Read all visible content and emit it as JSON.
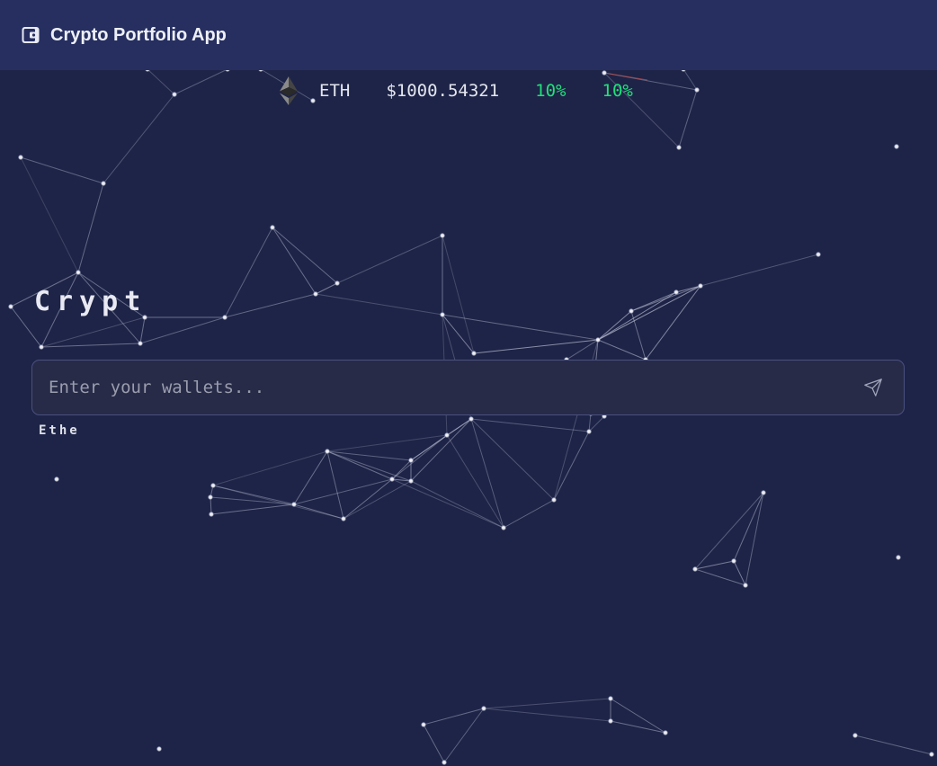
{
  "app": {
    "title": "Crypto Portfolio App",
    "icon": "wallet-icon"
  },
  "ticker": {
    "icon": "ethereum-icon",
    "symbol": "ETH",
    "price": "$1000.54321",
    "change_1": "10%",
    "change_2": "10%"
  },
  "hero": {
    "title": "Crypt",
    "subtitle": "Ethe"
  },
  "wallet_form": {
    "placeholder": "Enter your wallets...",
    "value": "",
    "send_icon": "send-icon"
  },
  "colors": {
    "background": "#1e2447",
    "navbar": "#262f60",
    "positive": "#21e07a",
    "input_bg": "#272b47",
    "input_border": "#4a5080"
  }
}
